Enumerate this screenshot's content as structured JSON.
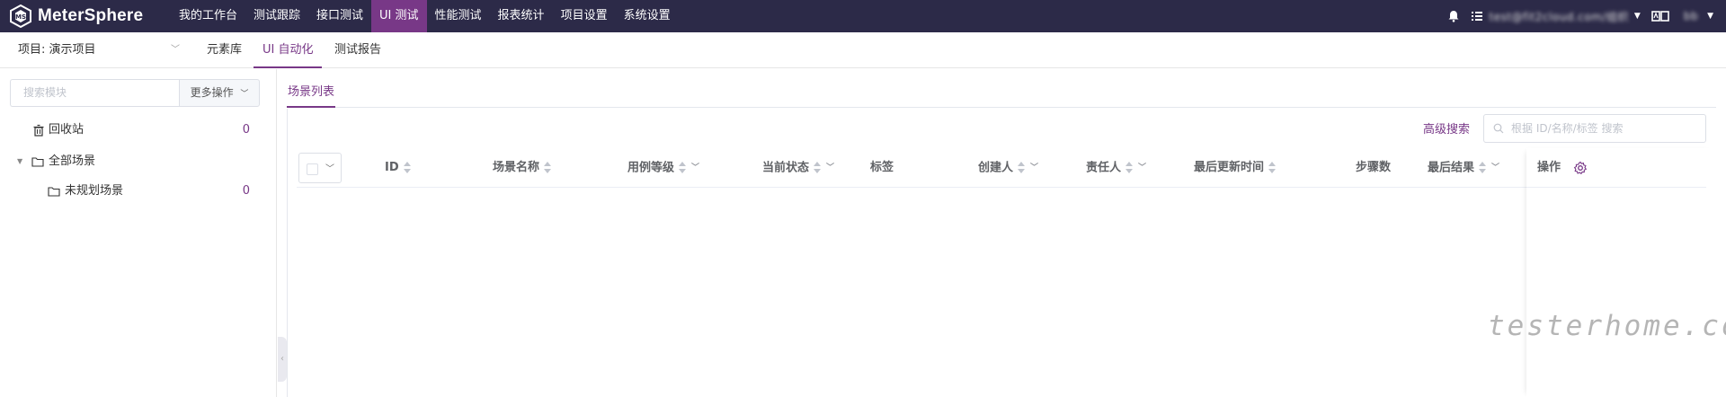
{
  "app": {
    "name": "MeterSphere"
  },
  "nav": {
    "items": [
      "我的工作台",
      "测试跟踪",
      "接口测试",
      "UI 测试",
      "性能测试",
      "报表统计",
      "项目设置",
      "系统设置"
    ],
    "active_index": 3
  },
  "topbar": {
    "user_blurred": "test@fit2cloud.com/组织"
  },
  "project": {
    "label": "项目: 演示项目"
  },
  "subtabs": {
    "elements": "元素库",
    "ui_auto": "UI 自动化",
    "report": "测试报告"
  },
  "left": {
    "search_placeholder": "搜索模块",
    "more_label": "更多操作",
    "recycle": {
      "label": "回收站",
      "count": "0"
    },
    "all_scenes": {
      "label": "全部场景"
    },
    "unplanned": {
      "label": "未规划场景",
      "count": "0"
    }
  },
  "main": {
    "tab_label": "场景列表",
    "advanced_search": "高级搜索",
    "search_placeholder": "根据 ID/名称/标签 搜索",
    "columns": {
      "id": "ID",
      "name": "场景名称",
      "level": "用例等级",
      "status": "当前状态",
      "tags": "标签",
      "creator": "创建人",
      "owner": "责任人",
      "updated": "最后更新时间",
      "steps": "步骤数",
      "last_result": "最后结果",
      "operation": "操作"
    }
  },
  "watermark": "testerhome.com",
  "colors": {
    "topbar": "#2c2a48",
    "accent": "#783887"
  }
}
